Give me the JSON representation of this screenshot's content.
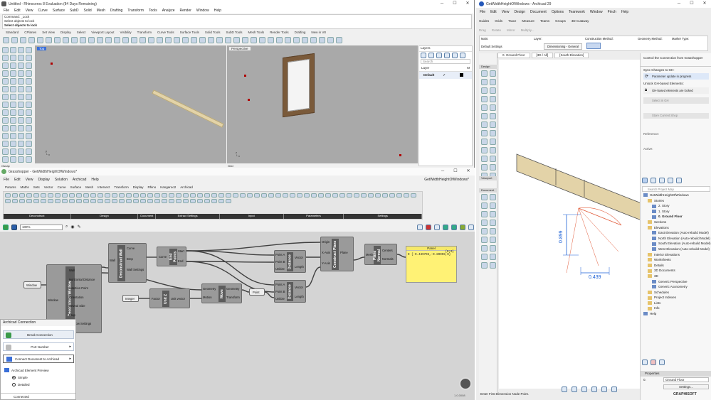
{
  "rhino": {
    "title": "Untitled - Rhinoceros 8 Evaluation (84 Days Remaining)",
    "menu": [
      "File",
      "Edit",
      "View",
      "Curve",
      "Surface",
      "SubD",
      "Solid",
      "Mesh",
      "Drafting",
      "Transform",
      "Tools",
      "Analyze",
      "Render",
      "Window",
      "Help"
    ],
    "command_lines": [
      "Command: _Lock",
      "Select objects to lock",
      "Select objects to lock"
    ],
    "tabs": [
      "Standard",
      "CPlanes",
      "Set View",
      "Display",
      "Select",
      "Viewport Layout",
      "Visibility",
      "Transform",
      "Curve Tools",
      "Surface Tools",
      "Solid Tools",
      "SubD Tools",
      "Mesh Tools",
      "Render Tools",
      "Drafting",
      "New in V8"
    ],
    "viewport_top": "Top",
    "viewport_perspective": "Perspective",
    "layers_panel": "Layers",
    "layers_search": "Search",
    "layer_header": "Layer",
    "layer_header_m": "M",
    "layer_default": "Default",
    "checkmark": "✓",
    "osnap": "Osnap",
    "grid_label": "Grid"
  },
  "grasshopper": {
    "title": "Grasshopper - GetWidthHeightOfWindows*",
    "doc_name": "GetWidthHeightOfWindows*",
    "menu": [
      "File",
      "Edit",
      "View",
      "Display",
      "Solution",
      "Archicad",
      "Help"
    ],
    "tabs": [
      "Params",
      "Maths",
      "Sets",
      "Vector",
      "Curve",
      "Surface",
      "Mesh",
      "Intersect",
      "Transform",
      "Display",
      "Rhino",
      "Kangaroo2",
      "Archicad"
    ],
    "groups": [
      "Deconstruct",
      "Design",
      "Document",
      "Extract Settings",
      "Input",
      "Parameters",
      "Settings"
    ],
    "zoom": "100%",
    "components": {
      "deconstruct_window": "Deconstruct Window",
      "deconstruct_wall": "Deconstruct Wall",
      "end_points": "End Points",
      "distance1": "Distance",
      "distance2": "Distance",
      "construct_plane": "Construct Plane",
      "plane_normal": "Plane Normal",
      "unit_z": "Unit Z",
      "move": "Move",
      "panel_title": "Panel",
      "panel_path": "{0;0}",
      "panel_value": "0 {-0.439703,-0.89059,0}",
      "window_param": "Window",
      "integer_param": "Integer",
      "point_param": "Point"
    },
    "ports": {
      "dw_in": "Window",
      "dw_out": [
        "Wall",
        "Horizontal Distance",
        "Insertion Point",
        "Orientation",
        "Reveal Side",
        "Brep",
        "Window Settings"
      ],
      "dwall_in": "Wall",
      "dwall_out": [
        "Curve",
        "Brep",
        "Wall Settings"
      ],
      "ep_in": "Curve",
      "ep_out": [
        "Start",
        "End"
      ],
      "d1_in": [
        "Point A",
        "Point B",
        "Unitize"
      ],
      "d1_out": [
        "Vector",
        "Length"
      ],
      "d2_in": [
        "Point A",
        "Point B",
        "Unitize"
      ],
      "d2_out": [
        "Vector",
        "Length"
      ],
      "cp_in": [
        "Origin",
        "X-Axis",
        "Y-Axis"
      ],
      "cp_out": "Plane",
      "pn_in": "Mesh",
      "pn_out": [
        "Centers",
        "Normals"
      ],
      "uz_in": "Factor",
      "uz_out": "Unit vector",
      "mv_in": [
        "Geometry",
        "Motion"
      ],
      "mv_out": [
        "Geometry",
        "Transform"
      ]
    },
    "version": "1.0.0008"
  },
  "archicad_connection": {
    "title": "Archicad Connection",
    "break_button": "Break Connection",
    "port_number": "Port Number",
    "connect_document": "Connect Document to Archicad",
    "preview_label": "Archicad Element Preview",
    "simple": "Simple",
    "detailed": "Detailed",
    "status": "Connected"
  },
  "archicad": {
    "title": "GetWidthHeightOfWindows - Archicad 29",
    "menu": [
      "File",
      "Edit",
      "View",
      "Design",
      "Document",
      "Options",
      "Teamwork",
      "Window",
      "Finch",
      "Help"
    ],
    "toolbar": [
      "Guides",
      "Grids",
      "Trace",
      "Measure",
      "Teams",
      "Groups",
      "3D Cutaway"
    ],
    "toolbar2": [
      "Drag",
      "Rotate",
      "Mirror",
      "Multiply..."
    ],
    "infobox": {
      "main": "Main:",
      "default_settings": "Default Settings",
      "layer": "Layer:",
      "layer_value": "Dimensioning - General",
      "construction_method": "Construction Method:",
      "geometry_method": "Geometry Method:",
      "marker_type": "Marker Type:"
    },
    "view_tabs": [
      "0. Ground Floor",
      "[3D / All]",
      "[South Elevation]"
    ],
    "toolbox_sections": [
      "Arrow",
      "Design",
      "Document",
      "Viewport"
    ],
    "dim_height": "0.899",
    "dim_width": "0.439",
    "status_bar": "Enter First Dimension Node Point.",
    "gh_panel": {
      "control_text": "Control the Connection from Grasshopper",
      "sync_label": "Sync Changes to GH:",
      "sync_status": "Parameter update in progress",
      "unlock_label": "Unlock GH-based Elements:",
      "locked_status": "GH-based elements are locked",
      "select_in_gh": "Select in GH",
      "reference": "Reference:",
      "active": "Active:",
      "store_button": "Store Current Shop"
    },
    "navigator": {
      "search": "Search Project Map",
      "items": [
        {
          "label": "GetWidthHeightOfWindows",
          "level": 0
        },
        {
          "label": "Stories",
          "level": 1
        },
        {
          "label": "2. Story",
          "level": 2
        },
        {
          "label": "1. Story",
          "level": 2
        },
        {
          "label": "0. Ground Floor",
          "level": 2
        },
        {
          "label": "Sections",
          "level": 1
        },
        {
          "label": "Elevations",
          "level": 1
        },
        {
          "label": "East Elevation (Auto-rebuild Model)",
          "level": 2
        },
        {
          "label": "North Elevation (Auto-rebuild Model)",
          "level": 2
        },
        {
          "label": "South Elevation (Auto-rebuild Model)",
          "level": 2
        },
        {
          "label": "West Elevation (Auto-rebuild Model)",
          "level": 2
        },
        {
          "label": "Interior Elevations",
          "level": 1
        },
        {
          "label": "Worksheets",
          "level": 1
        },
        {
          "label": "Details",
          "level": 1
        },
        {
          "label": "3D Documents",
          "level": 1
        },
        {
          "label": "3D",
          "level": 1
        },
        {
          "label": "Generic Perspective",
          "level": 2
        },
        {
          "label": "Generic Axonometry",
          "level": 2
        },
        {
          "label": "Schedules",
          "level": 1
        },
        {
          "label": "Project Indexes",
          "level": 1
        },
        {
          "label": "Lists",
          "level": 1
        },
        {
          "label": "Info",
          "level": 1
        },
        {
          "label": "Help",
          "level": 0
        }
      ]
    },
    "properties": "Properties",
    "prop_story": "0.",
    "prop_story_value": "Ground Floor",
    "settings_button": "Settings...",
    "brand": "GRAPHISOFT"
  },
  "colors": {
    "gh_canvas": "#d4d4d4",
    "panel_yellow": "#fff275",
    "dim_blue": "#1a5fd6",
    "wall_tan": "#e3d3a8",
    "rhino_viewport": "#a9a9a9"
  }
}
